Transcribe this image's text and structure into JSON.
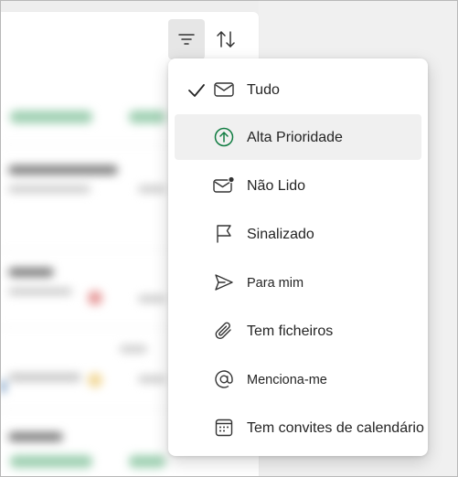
{
  "toolbar": {
    "filter_icon": "filter-lines-icon",
    "sort_icon": "sort-arrows-icon"
  },
  "filter_menu": {
    "selected_index": 0,
    "hovered_index": 1,
    "items": [
      {
        "label": "Tudo",
        "icon": "mail-icon",
        "checked": true
      },
      {
        "label": "Alta Prioridade",
        "icon": "arrow-up-circle-icon",
        "checked": false
      },
      {
        "label": "Não Lido",
        "icon": "mail-unread-icon",
        "checked": false
      },
      {
        "label": "Sinalizado",
        "icon": "flag-icon",
        "checked": false
      },
      {
        "label": "Para mim",
        "icon": "send-icon",
        "checked": false
      },
      {
        "label": "Tem ficheiros",
        "icon": "attach-icon",
        "checked": false
      },
      {
        "label": "Menciona-me",
        "icon": "at-sign-icon",
        "checked": false
      },
      {
        "label": "Tem convites de calendário",
        "icon": "calendar-icon",
        "checked": false
      }
    ]
  },
  "colors": {
    "accent_green": "#107c41",
    "hover_bg": "#f0f0f0"
  }
}
